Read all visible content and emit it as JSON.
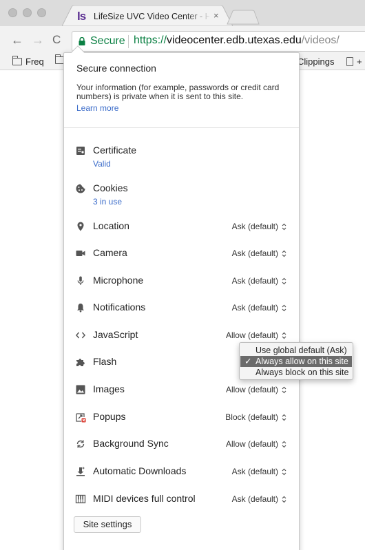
{
  "tab": {
    "favicon_text": "ls",
    "title": "LifeSize UVC Video Center - H",
    "close": "×"
  },
  "toolbar": {
    "back": "←",
    "forward": "→",
    "reload": "C",
    "secure_label": "Secure",
    "url_scheme": "https://",
    "url_host": "videocenter.edb.utexas.edu",
    "url_path": "/videos/"
  },
  "bookmarks": {
    "items": [
      "Freq",
      "Clippings",
      "+"
    ]
  },
  "popup": {
    "title": "Secure connection",
    "description": "Your information (for example, passwords or credit card numbers) is private when it is sent to this site.",
    "learn_more": "Learn more",
    "certificate": {
      "label": "Certificate",
      "status": "Valid"
    },
    "cookies": {
      "label": "Cookies",
      "status": "3 in use"
    },
    "permissions": [
      {
        "label": "Location",
        "value": "Ask (default)",
        "icon": "location-pin-icon"
      },
      {
        "label": "Camera",
        "value": "Ask (default)",
        "icon": "camera-icon"
      },
      {
        "label": "Microphone",
        "value": "Ask (default)",
        "icon": "microphone-icon"
      },
      {
        "label": "Notifications",
        "value": "Ask (default)",
        "icon": "bell-icon"
      },
      {
        "label": "JavaScript",
        "value": "Allow (default)",
        "icon": "code-brackets-icon"
      },
      {
        "label": "Flash",
        "value": "",
        "icon": "puzzle-piece-icon"
      },
      {
        "label": "Images",
        "value": "Allow (default)",
        "icon": "image-icon"
      },
      {
        "label": "Popups",
        "value": "Block (default)",
        "icon": "popup-blocked-icon"
      },
      {
        "label": "Background Sync",
        "value": "Allow (default)",
        "icon": "sync-icon"
      },
      {
        "label": "Automatic Downloads",
        "value": "Ask (default)",
        "icon": "download-icon"
      },
      {
        "label": "MIDI devices full control",
        "value": "Ask (default)",
        "icon": "midi-keyboard-icon"
      }
    ],
    "site_settings": "Site settings"
  },
  "flash_menu": {
    "options": [
      "Use global default (Ask)",
      "Always allow on this site",
      "Always block on this site"
    ],
    "selected": "Always allow on this site",
    "check": "✓"
  },
  "colors": {
    "secure_green": "#0b8043",
    "link_blue": "#3a6bc9",
    "favicon_purple": "#5a2d91",
    "menu_selected": "#6b6b6b"
  }
}
